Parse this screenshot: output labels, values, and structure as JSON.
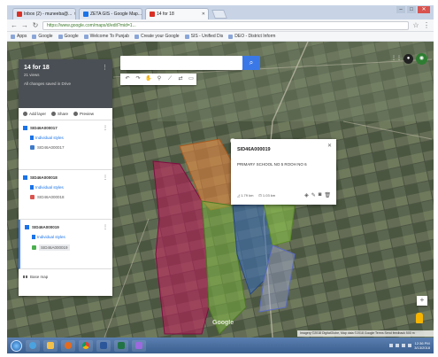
{
  "browser": {
    "tabs": [
      {
        "label": "Inbox (2) - muneeba@...",
        "favicon_color": "#d93025",
        "active": false
      },
      {
        "label": "ZETA GIS - Google Map...",
        "favicon_color": "#1a73e8",
        "active": false
      },
      {
        "label": "14 for 18",
        "favicon_color": "#d93025",
        "active": true
      }
    ],
    "url": "https://www.google.com/maps/d/edit?mid=1...",
    "bookmarks": [
      "Apps",
      "Google",
      "Google",
      "Welcome To Punjab",
      "Create your Google",
      "SIS - Unified Dis",
      "DEO - District Inform"
    ]
  },
  "panel": {
    "title": "14 for 18",
    "subtitle": "21 views",
    "saved": "All changes saved in Drive",
    "actions": {
      "add_layer": "Add layer",
      "share": "Share",
      "preview": "Preview"
    },
    "layers": [
      {
        "name": "SID46A000017",
        "style_label": "Individual styles",
        "item": "SID46A000017",
        "item_color": "#3e7ac9",
        "selected": false
      },
      {
        "name": "SID46A000018",
        "style_label": "Individual styles",
        "item": "SID46A000018",
        "item_color": "#d9534f",
        "selected": false
      },
      {
        "name": "SID46A000019",
        "style_label": "Individual styles",
        "item": "SID46A000019",
        "item_color": "#4caf50",
        "selected": true
      }
    ],
    "base_map": "Base map"
  },
  "search": {
    "button_icon": "search-icon"
  },
  "popup": {
    "title": "SID46A000019",
    "description": "PRIMARY SCHOOL NO 5 ROOH NO 6",
    "area": "1.79 km",
    "perimeter": "1.03 km"
  },
  "map": {
    "attribution": "Imagery ©2018 DigitalGlobe, Map data ©2018 Google  Terms  Send feedback  500 m",
    "google_logo": "Google"
  },
  "taskbar": {
    "time": "12:36 PM",
    "date": "3/13/2018"
  }
}
